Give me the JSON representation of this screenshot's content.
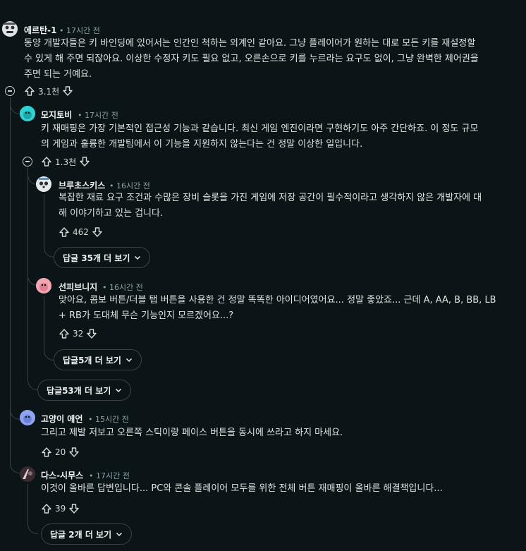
{
  "comments": [
    {
      "username": "에르탄-1",
      "time": "17시간 전",
      "lines": [
        "동양 개발자들은 키 바인딩에 있어서는 인간인 척하는 외계인 같아요. 그냥 플레이어가 원하는 대로 모든 키를 재설정할",
        "수 있게 해 주면 되잖아요. 이상한 수정자 키도 필요 없고, 오른손으로 키를 누르라는 요구도 없이, 그냥 완벽한 제어권을",
        "주면 되는 거예요."
      ],
      "votes": "3.1천"
    },
    {
      "username": "모지토비",
      "time": "17시간 전",
      "lines": [
        "키 재매핑은 가장 기본적인 접근성 기능과 같습니다. 최신 게임 엔진이라면 구현하기도 아주 간단하죠. 이 정도 규모",
        "의 게임과 훌륭한 개발팀에서 이 기능을 지원하지 않는다는 건 정말 이상한 일입니다."
      ],
      "votes": "1.3천"
    },
    {
      "username": "브루초스키스",
      "time": "16시간 전",
      "lines": [
        "복잡한 재료 요구 조건과 수많은 장비 슬롯을 가진 게임에 저장 공간이 필수적이라고 생각하지 않은 개발자에 대",
        "해 이야기하고 있는 겁니다."
      ],
      "votes": "462",
      "more": "답글 35개 더 보기"
    },
    {
      "username": "선피브니지",
      "time": "16시간 전",
      "lines": [
        "맞아요, 콤보 버튼/더블 탭 버튼을 사용한 건 정말 똑똑한 아이디어였어요... 정말 좋았죠... 근데 A, AA, B, BB, LB",
        "+ RB가 도대체 무슨 기능인지 모르겠어요...?"
      ],
      "votes": "32",
      "more": "답글5개 더 보기"
    },
    {
      "username": "고양이 에언",
      "time": "15시간 전",
      "lines": [
        "그리고 제발 저보고 오른쪽 스틱이랑 페이스 버튼을 동시에 쓰라고 하지 마세요."
      ],
      "votes": "20"
    },
    {
      "username": "다스-시무스",
      "time": "17시간 전",
      "lines": [
        "이것이 올바른 답변입니다... PC와 콘솔 플레이어 모두를 위한 전체 버튼 재매핑이 올바른 해결책입니다..."
      ],
      "votes": "39",
      "more": "답글 2개 더 보기"
    }
  ],
  "thread_more": "답글53개 더 보기",
  "icons": {
    "upvote": "arrow-up-icon",
    "downvote": "arrow-down-icon",
    "collapse": "collapse-minus-icon",
    "chevron": "chevron-down-icon"
  },
  "colors": {
    "background": "#0b1416",
    "thread_line": "#3a4347",
    "avatar_teal": "#2fd3d3",
    "avatar_pink": "#f4a6b3",
    "avatar_blue": "#8fa3f0"
  }
}
